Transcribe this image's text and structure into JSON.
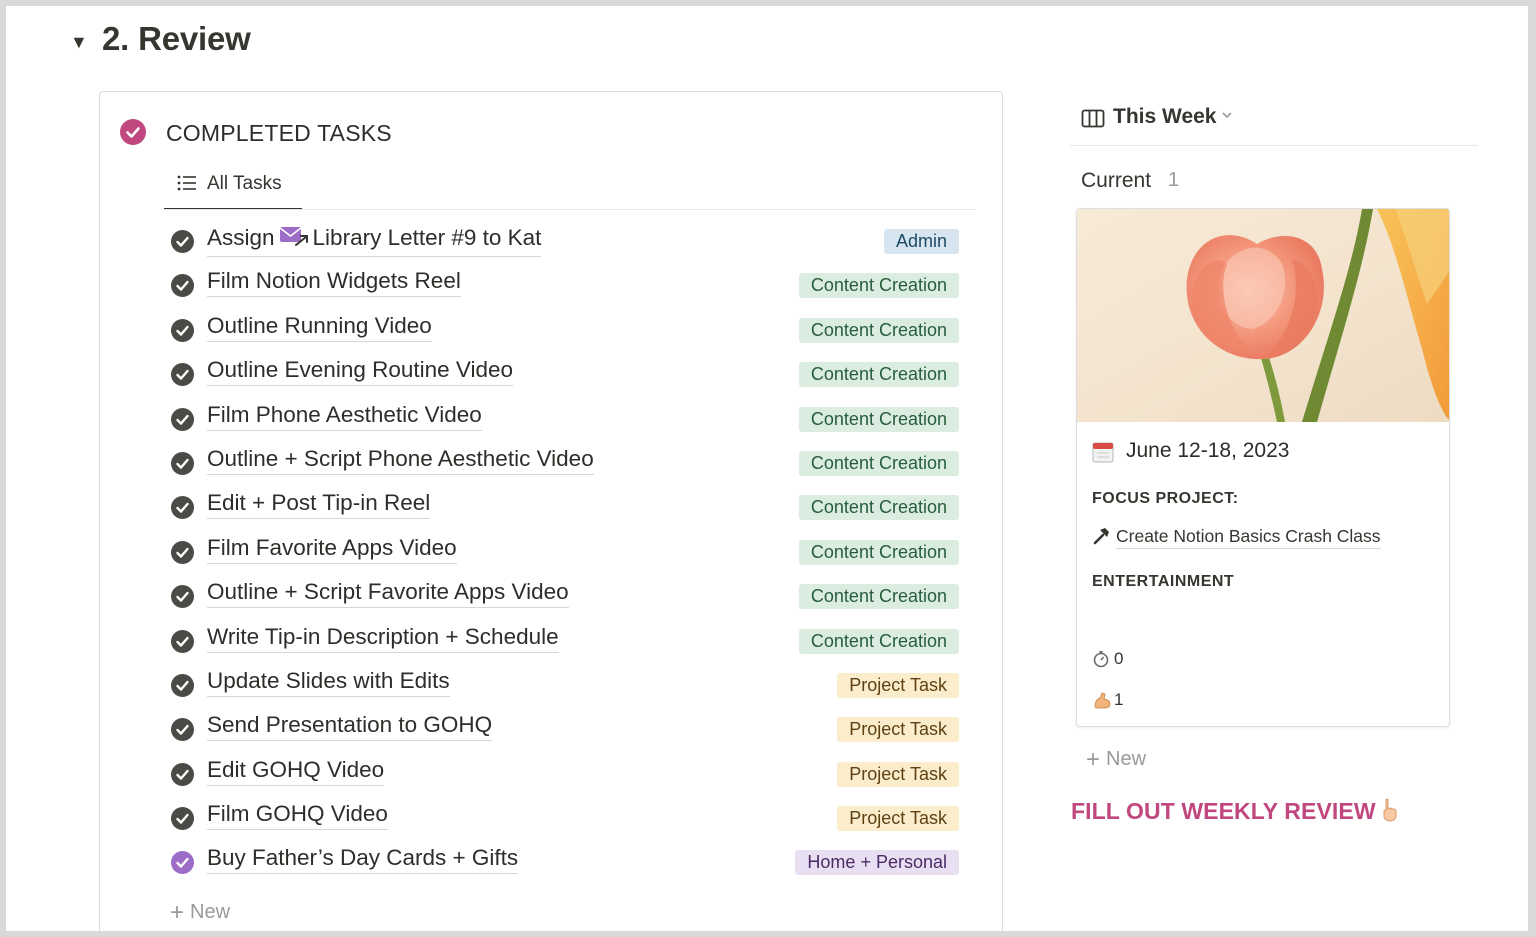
{
  "section": {
    "title": "2. Review",
    "toggle": "▼"
  },
  "tasks_panel": {
    "title": "COMPLETED TASKS",
    "view_tab": "All Tasks",
    "new_label": "New",
    "tasks": [
      {
        "name_prefix": "Assign",
        "name": "Library Letter #9 to Kat",
        "tag": "Admin",
        "tag_type": "admin",
        "has_mail_icon": true
      },
      {
        "name": "Film Notion Widgets Reel",
        "tag": "Content Creation",
        "tag_type": "content"
      },
      {
        "name": "Outline Running Video",
        "tag": "Content Creation",
        "tag_type": "content"
      },
      {
        "name": "Outline Evening Routine Video",
        "tag": "Content Creation",
        "tag_type": "content"
      },
      {
        "name": "Film Phone Aesthetic Video",
        "tag": "Content Creation",
        "tag_type": "content"
      },
      {
        "name": "Outline + Script Phone Aesthetic Video",
        "tag": "Content Creation",
        "tag_type": "content"
      },
      {
        "name": "Edit + Post Tip-in Reel",
        "tag": "Content Creation",
        "tag_type": "content"
      },
      {
        "name": "Film Favorite Apps Video",
        "tag": "Content Creation",
        "tag_type": "content"
      },
      {
        "name": "Outline + Script Favorite Apps Video",
        "tag": "Content Creation",
        "tag_type": "content"
      },
      {
        "name": "Write Tip-in Description + Schedule",
        "tag": "Content Creation",
        "tag_type": "content"
      },
      {
        "name": "Update Slides with Edits",
        "tag": "Project Task",
        "tag_type": "project"
      },
      {
        "name": "Send Presentation to GOHQ",
        "tag": "Project Task",
        "tag_type": "project"
      },
      {
        "name": "Edit GOHQ Video",
        "tag": "Project Task",
        "tag_type": "project"
      },
      {
        "name": "Film GOHQ Video",
        "tag": "Project Task",
        "tag_type": "project"
      },
      {
        "name": "Buy Father’s Day Cards + Gifts",
        "tag": "Home + Personal",
        "tag_type": "home",
        "icon_color": "purple"
      }
    ]
  },
  "board": {
    "view_title": "This Week",
    "group_label": "Current",
    "group_count": "1",
    "card": {
      "image_icon": "tulip-photo",
      "date": "June 12-18, 2023",
      "focus_label": "FOCUS PROJECT:",
      "focus_project": "Create Notion Basics Crash Class",
      "entertainment_label": "ENTERTAINMENT",
      "timer_value": "0",
      "arm_value": "1"
    },
    "new_label": "New"
  },
  "fill_link": "FILL OUT WEEKLY REVIEW",
  "colors": {
    "accent_pink": "#c0487f",
    "tag_content_bg": "#dbede0",
    "tag_project_bg": "#fbeccb",
    "tag_admin_bg": "#d6e5ef",
    "tag_home_bg": "#e9dff2"
  }
}
